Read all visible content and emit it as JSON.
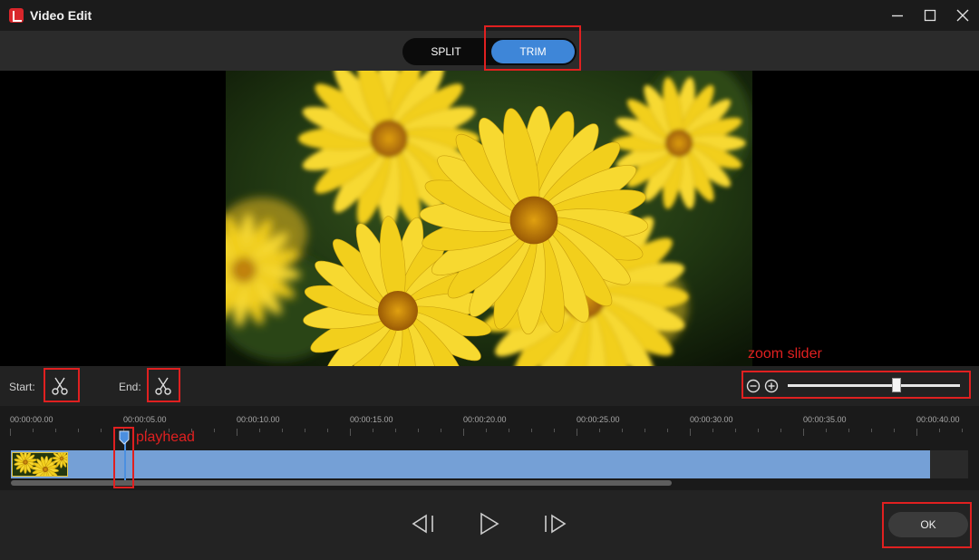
{
  "window": {
    "title": "Video Edit"
  },
  "tabs": {
    "split_label": "SPLIT",
    "trim_label": "TRIM",
    "active": "TRIM"
  },
  "trim": {
    "start_label": "Start:",
    "end_label": "End:"
  },
  "zoom": {
    "level": 0.63
  },
  "timeline": {
    "ruler": [
      "00:00:00.00",
      "00:00:05.00",
      "00:00:10.00",
      "00:00:15.00",
      "00:00:20.00",
      "00:00:25.00",
      "00:00:30.00",
      "00:00:35.00",
      "00:00:40.00"
    ],
    "scroll_fraction": 0.69
  },
  "playback": {
    "ok_label": "OK"
  },
  "annotations": {
    "zoom_slider": "zoom slider",
    "playhead": "playhead"
  },
  "colors": {
    "accent": "#3e86d8",
    "track": "#75a0d6",
    "highlight": "#e02020"
  },
  "icons": {
    "app": "app-logo-icon",
    "minimize": "minimize-icon",
    "maximize": "maximize-icon",
    "close": "close-icon",
    "scissors": "scissors-icon",
    "zoom_out": "zoom-out-icon",
    "zoom_in": "zoom-in-icon",
    "prev_frame": "previous-frame-icon",
    "play": "play-icon",
    "next_frame": "next-frame-icon"
  }
}
